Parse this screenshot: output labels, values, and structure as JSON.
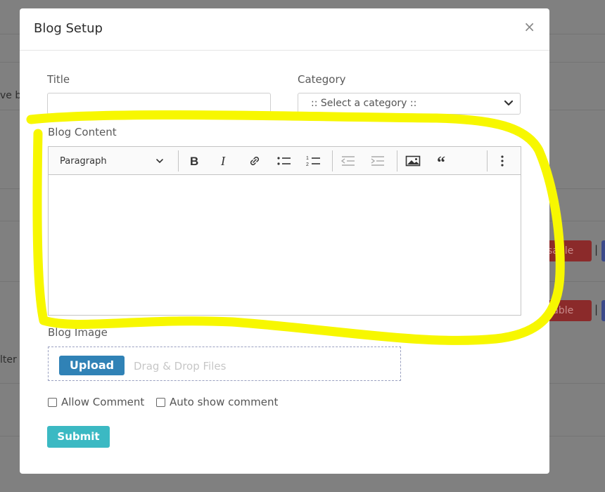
{
  "background": {
    "fragments": [
      "ve b",
      "lter"
    ],
    "disable_label": "sable",
    "pipe": "|"
  },
  "modal": {
    "title": "Blog Setup",
    "close": "×"
  },
  "form": {
    "title_label": "Title",
    "title_value": "",
    "category_label": "Category",
    "category_selected": ":: Select a category ::",
    "content_label": "Blog Content",
    "image_label": "Blog Image",
    "upload_button": "Upload",
    "upload_hint": "Drag & Drop Files",
    "allow_comment": "Allow Comment",
    "auto_show_comment": "Auto show comment",
    "submit": "Submit"
  },
  "editor": {
    "paragraph_style": "Paragraph",
    "toolbar": [
      "bold-icon",
      "italic-icon",
      "link-icon",
      "bulleted-list-icon",
      "numbered-list-icon",
      "outdent-icon",
      "indent-icon",
      "image-icon",
      "blockquote-icon",
      "more-icon"
    ]
  },
  "colors": {
    "upload_button": "#3082b6",
    "submit_button": "#3bb9c3",
    "highlight": "#f7f700"
  }
}
